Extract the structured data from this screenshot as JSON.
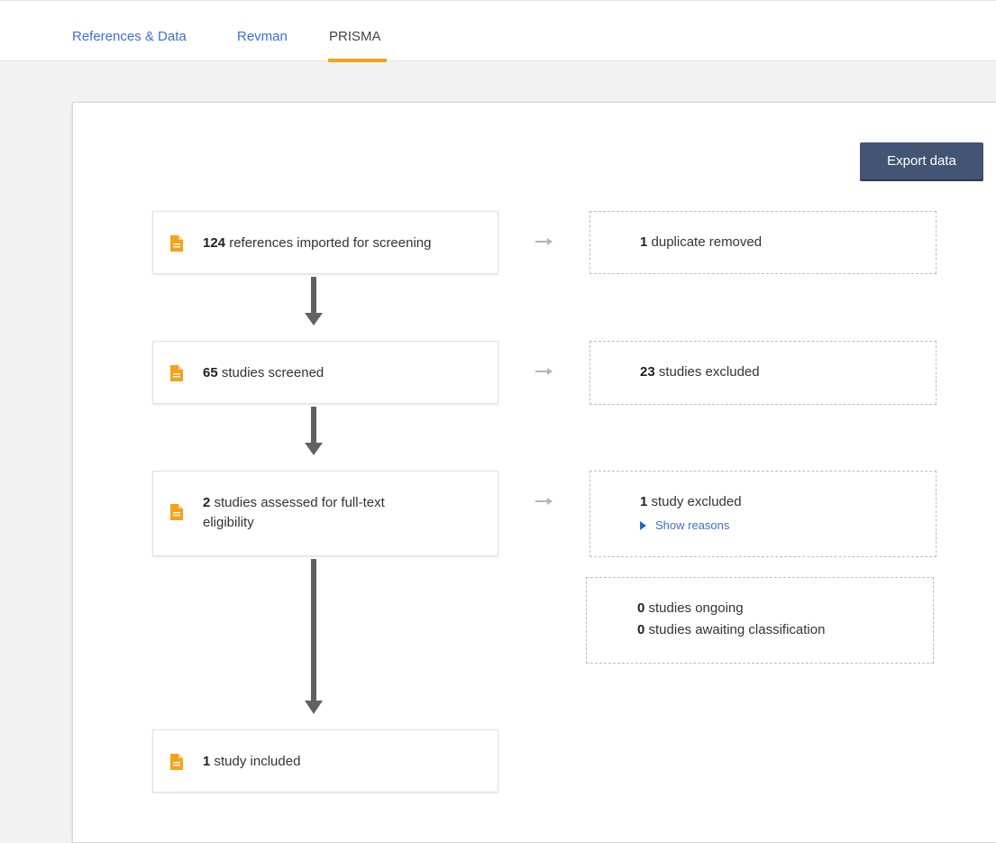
{
  "tabs": [
    {
      "label": "References & Data",
      "active": false
    },
    {
      "label": "Revman",
      "active": false
    },
    {
      "label": "PRISMA",
      "active": true
    }
  ],
  "export_label": "Export data",
  "flow": {
    "imported": {
      "count": "124",
      "text": "references imported for screening"
    },
    "screened": {
      "count": "65",
      "text": "studies screened"
    },
    "assessed": {
      "count": "2",
      "text": "studies assessed for full-text eligibility"
    },
    "included": {
      "count": "1",
      "text": "study included"
    }
  },
  "side": {
    "duplicates": {
      "count": "1",
      "text": "duplicate removed"
    },
    "excluded_screening": {
      "count": "23",
      "text": "studies excluded"
    },
    "excluded_fulltext": {
      "count": "1",
      "text": "study excluded",
      "reasons_label": "Show reasons"
    },
    "ongoing": {
      "count": "0",
      "text": "studies ongoing"
    },
    "awaiting": {
      "count": "0",
      "text": "studies awaiting classification"
    }
  },
  "colors": {
    "accent": "#f5a21a",
    "link": "#3f6fd3",
    "button": "#435474",
    "arrow": "#616161"
  }
}
